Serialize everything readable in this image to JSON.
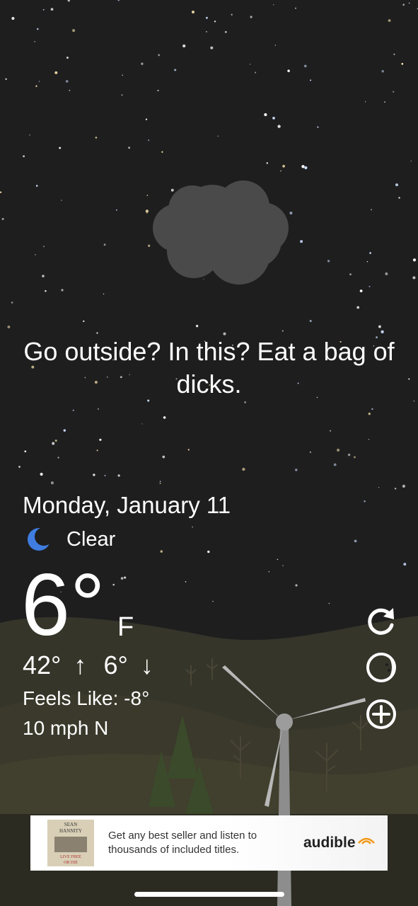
{
  "quip": "Go outside? In this? Eat a bag of dicks.",
  "date": "Monday, January 11",
  "condition": {
    "icon": "crescent-moon-icon",
    "text": "Clear"
  },
  "temperature": {
    "value": "6°",
    "unit": "F"
  },
  "high": "42°",
  "low": "6°",
  "feels_like": "Feels Like: -8°",
  "wind": "10 mph N",
  "side_buttons": [
    "refresh-icon",
    "theme-toggle-icon",
    "add-location-icon"
  ],
  "ad": {
    "cover_lines": [
      "SEAN",
      "HANNITY",
      "LIVE FREE",
      "OR DIE"
    ],
    "text": "Get any best seller and listen to thousands of included titles.",
    "brand": "audible"
  },
  "colors": {
    "sky": "#1e1e1f",
    "moon": "#3f7de0",
    "hills": "#3b3a2a"
  }
}
